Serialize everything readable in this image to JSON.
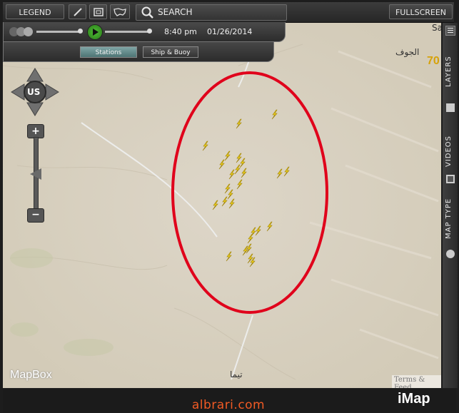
{
  "toolbar": {
    "legend_label": "LEGEND",
    "search_placeholder": "SEARCH",
    "fullscreen_label": "FULLSCREEN",
    "icons": [
      "pencil-icon",
      "layout-icon",
      "us-map-icon",
      "search-icon"
    ]
  },
  "timeline": {
    "time": "8:40 pm",
    "date": "01/26/2014",
    "accent": "#3fa62b"
  },
  "layer_tabs": [
    "Stations",
    "Ship & Buoy"
  ],
  "map": {
    "nav_label": "US",
    "labels": {
      "top_right": "Sa",
      "city_jawf": "الجوف",
      "city_tayma": "تيما"
    },
    "temp_badge": "70",
    "credit": "MapBox",
    "terms": "Terms & Feed",
    "highlight_color": "#e0001b",
    "lightning_color": "#f0d21a",
    "lightning_icon": "lightning-icon"
  },
  "sidebar": {
    "tabs": [
      "LAYERS",
      "VIDEOS",
      "MAP TYPE"
    ]
  },
  "footer": {
    "watermark": "albrari.com",
    "logo": "iMap"
  }
}
